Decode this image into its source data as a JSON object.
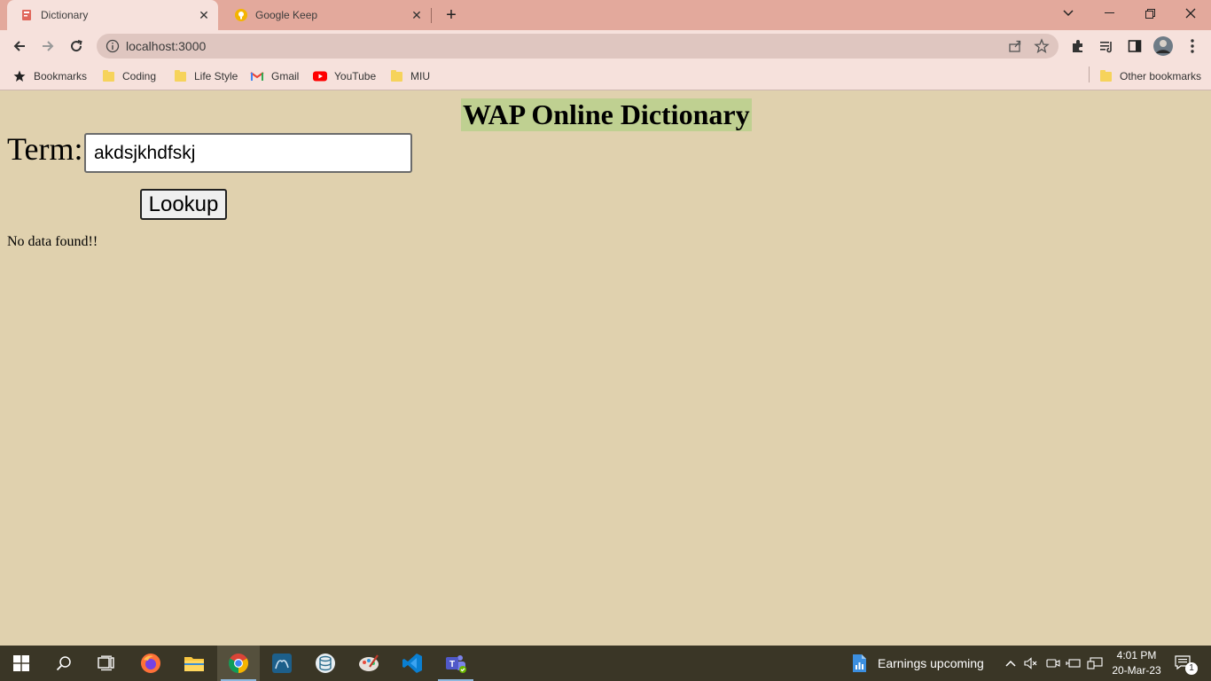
{
  "browser": {
    "tabs": [
      {
        "title": "Dictionary",
        "active": true
      },
      {
        "title": "Google Keep",
        "active": false
      }
    ],
    "address": "localhost:3000",
    "bookmarks": [
      {
        "label": "Bookmarks",
        "icon": "star-icon"
      },
      {
        "label": "Coding",
        "icon": "folder-icon"
      },
      {
        "label": "Life Style",
        "icon": "folder-icon"
      },
      {
        "label": "Gmail",
        "icon": "gmail-icon"
      },
      {
        "label": "YouTube",
        "icon": "youtube-icon"
      },
      {
        "label": "MIU",
        "icon": "folder-icon"
      }
    ],
    "other_bookmarks": "Other bookmarks"
  },
  "page": {
    "heading": "WAP Online Dictionary",
    "term_label": "Term:",
    "term_value": "akdsjkhdfskj",
    "lookup_label": "Lookup",
    "result_text": "No data found!!"
  },
  "taskbar": {
    "widget_text": "Earnings upcoming",
    "time": "4:01 PM",
    "date": "20-Mar-23",
    "notification_count": "1"
  },
  "colors": {
    "page_background": "#e0d1ae",
    "heading_highlight": "#bfd091",
    "tab_strip": "#e3a99c",
    "toolbar": "#f6e1dc",
    "taskbar": "#3a3626"
  }
}
